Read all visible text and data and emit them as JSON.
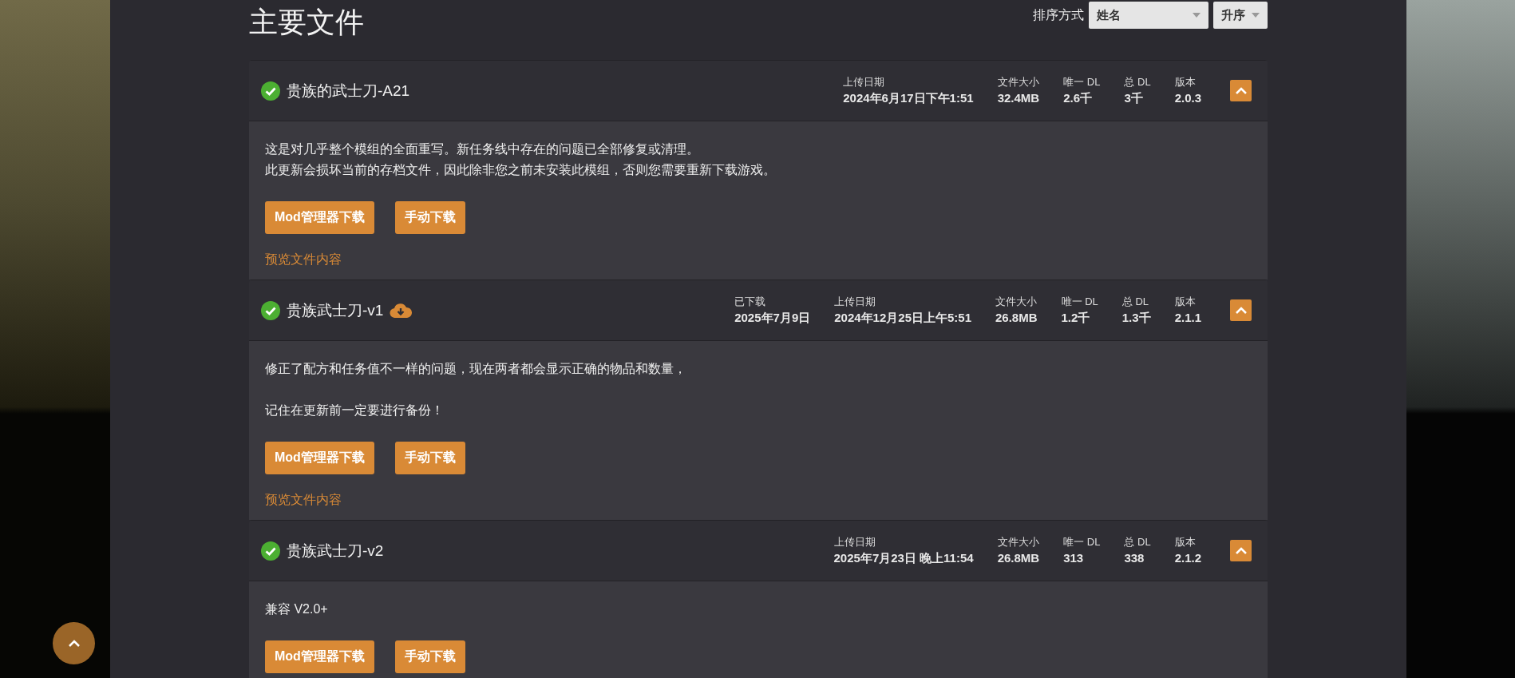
{
  "title": "主要文件",
  "sort": {
    "label": "排序方式",
    "field": "姓名",
    "order": "升序"
  },
  "files": [
    {
      "name": "贵族的武士刀-A21",
      "verified": true,
      "downloaded": false,
      "expanded": true,
      "meta": [
        {
          "label": "上传日期",
          "value": "2024年6月17日下午1:51"
        },
        {
          "label": "文件大小",
          "value": "32.4MB"
        },
        {
          "label": "唯一 DL",
          "value": "2.6千"
        },
        {
          "label": "总 DL",
          "value": "3千"
        },
        {
          "label": "版本",
          "value": "2.0.3"
        }
      ],
      "description": [
        [
          "这是对几乎整个模组的全面重写。新任务线中存在的问题已全部修复或清理。",
          "此更新会损坏当前的存档文件，因此除非您之前未安装此模组，否则您需要重新下载游戏。"
        ]
      ],
      "buttons": [
        "Mod管理器下载",
        "手动下载"
      ],
      "preview": "预览文件内容"
    },
    {
      "name": "贵族武士刀-v1",
      "verified": true,
      "downloaded": true,
      "expanded": true,
      "meta": [
        {
          "label": "已下载",
          "value": "2025年7月9日"
        },
        {
          "label": "上传日期",
          "value": "2024年12月25日上午5:51"
        },
        {
          "label": "文件大小",
          "value": "26.8MB"
        },
        {
          "label": "唯一 DL",
          "value": "1.2千"
        },
        {
          "label": "总 DL",
          "value": "1.3千"
        },
        {
          "label": "版本",
          "value": "2.1.1"
        }
      ],
      "description": [
        [
          "修正了配方和任务值不一样的问题，现在两者都会显示正确的物品和数量，"
        ],
        [
          "记住在更新前一定要进行备份！"
        ]
      ],
      "buttons": [
        "Mod管理器下载",
        "手动下载"
      ],
      "preview": "预览文件内容"
    },
    {
      "name": "贵族武士刀-v2",
      "verified": true,
      "downloaded": false,
      "expanded": true,
      "meta": [
        {
          "label": "上传日期",
          "value": "2025年7月23日 晚上11:54"
        },
        {
          "label": "文件大小",
          "value": "26.8MB"
        },
        {
          "label": "唯一 DL",
          "value": "313"
        },
        {
          "label": "总 DL",
          "value": "338"
        },
        {
          "label": "版本",
          "value": "2.1.2"
        }
      ],
      "description": [
        [
          "兼容 V2.0+"
        ]
      ],
      "buttons": [
        "Mod管理器下载",
        "手动下载"
      ]
    }
  ]
}
